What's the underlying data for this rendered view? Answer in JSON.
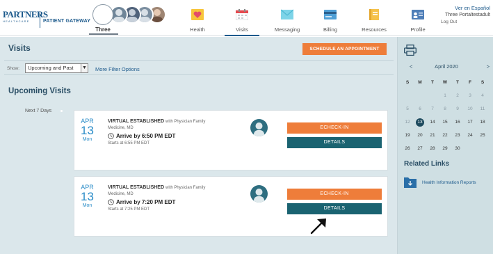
{
  "header": {
    "logo_main": "PARTNERS",
    "logo_sub": "HEALTHCARE",
    "gateway": "PATIENT GATEWAY",
    "current_user": "Three",
    "nav": [
      {
        "label": "Health",
        "icon": "heart-icon"
      },
      {
        "label": "Visits",
        "icon": "calendar-icon",
        "active": true
      },
      {
        "label": "Messaging",
        "icon": "envelope-icon"
      },
      {
        "label": "Billing",
        "icon": "credit-card-icon"
      },
      {
        "label": "Resources",
        "icon": "notebook-icon"
      },
      {
        "label": "Profile",
        "icon": "id-card-icon"
      }
    ],
    "language_link": "Ver en Español",
    "user_name": "Three Portaltestadult",
    "logout": "Log Out"
  },
  "colors": {
    "brand_blue": "#1d5a8c",
    "orange": "#ee7d3a",
    "teal": "#1a6371",
    "date_blue": "#2a8cc8",
    "main_bg": "#dbe7eb",
    "sidebar_bg": "#cfdfe3"
  },
  "visits": {
    "title": "Visits",
    "schedule_button": "SCHEDULE AN APPOINTMENT",
    "show_label": "Show:",
    "show_value": "Upcoming and Past",
    "more_filters": "More Filter Options",
    "section_title": "Upcoming Visits",
    "period_label": "Next 7 Days",
    "cards": [
      {
        "month": "APR",
        "day": "13",
        "dow": "Mon",
        "visit_type": "VIRTUAL ESTABLISHED",
        "with_text": "with Physician Family",
        "provider": "Medicine, MD",
        "arrive": "Arrive by 6:50 PM EDT",
        "starts": "Starts at 6:55 PM EDT",
        "echeckin": "ECHECK-IN",
        "details": "DETAILS"
      },
      {
        "month": "APR",
        "day": "13",
        "dow": "Mon",
        "visit_type": "VIRTUAL ESTABLISHED",
        "with_text": "with Physician Family",
        "provider": "Medicine, MD",
        "arrive": "Arrive by 7:20 PM EDT",
        "starts": "Starts at 7:25 PM EDT",
        "echeckin": "ECHECK-IN",
        "details": "DETAILS"
      }
    ]
  },
  "calendar": {
    "prev": "<",
    "next": ">",
    "title": "April 2020",
    "dows": [
      "S",
      "M",
      "T",
      "W",
      "T",
      "F",
      "S"
    ],
    "weeks": [
      [
        "",
        "",
        "",
        "1",
        "2",
        "3",
        "4"
      ],
      [
        "5",
        "6",
        "7",
        "8",
        "9",
        "10",
        "11"
      ],
      [
        "12",
        "13",
        "14",
        "15",
        "16",
        "17",
        "18"
      ],
      [
        "19",
        "20",
        "21",
        "22",
        "23",
        "24",
        "25"
      ],
      [
        "26",
        "27",
        "28",
        "29",
        "30",
        "",
        ""
      ]
    ],
    "today": "13"
  },
  "related": {
    "title": "Related Links",
    "items": [
      {
        "label": "Health Information Reports",
        "icon": "folder-download-icon"
      }
    ]
  }
}
